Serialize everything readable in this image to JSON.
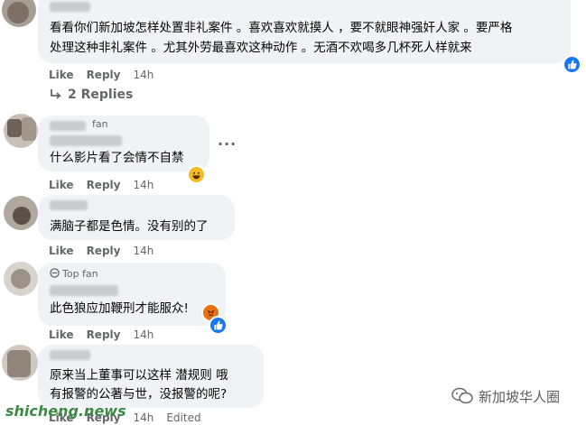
{
  "comments": [
    {
      "lines": [
        "看看你们新加坡怎样处置非礼案件 。喜欢喜欢就摸人 ，要不就眼神强奸人家 。要严格",
        "处理这种非礼案件 。尤其外劳最喜欢这种动作 。无酒不欢喝多几杯死人样就来"
      ],
      "actions": {
        "like": "Like",
        "reply": "Reply",
        "time": "14h"
      },
      "reaction": "like-icon"
    },
    {
      "lines": [
        "什么影片看了会情不自禁"
      ],
      "actions": {
        "like": "Like",
        "reply": "Reply",
        "time": "14h"
      },
      "reaction": "haha-icon"
    },
    {
      "lines": [
        "满脑子都是色情。没有别的了"
      ],
      "actions": {
        "like": "Like",
        "reply": "Reply",
        "time": "14h"
      }
    },
    {
      "badge": "Top fan",
      "lines": [
        "此色狼应加鞭刑才能服众!"
      ],
      "actions": {
        "like": "Like",
        "reply": "Reply",
        "time": "14h"
      },
      "reaction": "angry-like-icons"
    },
    {
      "lines": [
        "原来当上董事可以这样 潜规则 哦",
        "有报警的公著与世，没报警的呢?"
      ],
      "actions": {
        "like": "Like",
        "reply": "Reply",
        "time": "14h",
        "edited": "Edited"
      }
    }
  ],
  "replies_link": "2 Replies",
  "partial_name": "fan",
  "watermark": {
    "site": "shicheng.news",
    "brand": "新加坡华人圈"
  },
  "colors": {
    "bubble": "#f0f2f5",
    "action": "#65676b",
    "like": "#1877f2"
  }
}
